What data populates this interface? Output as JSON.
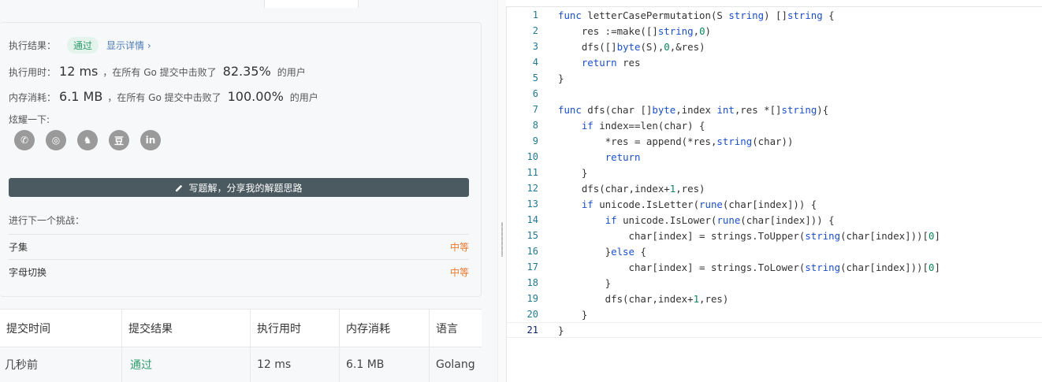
{
  "result": {
    "label": "执行结果：",
    "status": "通过",
    "details_link": "显示详情 ›",
    "runtime_label": "执行用时：",
    "runtime_value": "12 ms",
    "runtime_mid": "，在所有 Go 提交中击败了",
    "runtime_pct": "82.35%",
    "runtime_tail": "的用户",
    "memory_label": "内存消耗：",
    "memory_value": "6.1 MB",
    "memory_mid": "，在所有 Go 提交中击败了",
    "memory_pct": "100.00%",
    "memory_tail": "的用户",
    "share_label": "炫耀一下:",
    "share_icons": [
      "wechat-icon",
      "weibo-icon",
      "qq-icon",
      "douban-icon",
      "linkedin-icon"
    ],
    "share_glyphs": [
      "✆",
      "◎",
      "♞",
      "豆",
      "in"
    ],
    "write_button": "写题解，分享我的解题思路",
    "next_label": "进行下一个挑战：",
    "challenges": [
      {
        "name": "子集",
        "difficulty": "中等"
      },
      {
        "name": "字母切换",
        "difficulty": "中等"
      }
    ]
  },
  "table": {
    "headers": [
      "提交时间",
      "提交结果",
      "执行用时",
      "内存消耗",
      "语言"
    ],
    "rows": [
      [
        "几秒前",
        "通过",
        "12 ms",
        "6.1 MB",
        "Golang"
      ]
    ]
  },
  "editor": {
    "line_numbers": [
      "1",
      "2",
      "3",
      "4",
      "5",
      "6",
      "7",
      "8",
      "9",
      "10",
      "11",
      "12",
      "13",
      "14",
      "15",
      "16",
      "17",
      "18",
      "19",
      "20",
      "21"
    ],
    "lines": [
      "func letterCasePermutation(S string) []string {",
      "    res :=make([]string,0)",
      "    dfs([]byte(S),0,&res)",
      "    return res",
      "}",
      "",
      "func dfs(char []byte,index int,res *[]string){",
      "    if index==len(char) {",
      "        *res = append(*res,string(char))",
      "        return",
      "    }",
      "    dfs(char,index+1,res)",
      "    if unicode.IsLetter(rune(char[index])) {",
      "        if unicode.IsLower(rune(char[index])) {",
      "            char[index] = strings.ToUpper(string(char[index]))[0]",
      "        }else {",
      "            char[index] = strings.ToLower(string(char[index]))[0]",
      "        }",
      "        dfs(char,index+1,res)",
      "    }",
      "}"
    ]
  },
  "colors": {
    "accent_green": "#2d9c6c",
    "difficulty_orange": "#e8792f",
    "button_bg": "#4b5960",
    "keyword_blue": "#1a4fc9"
  }
}
